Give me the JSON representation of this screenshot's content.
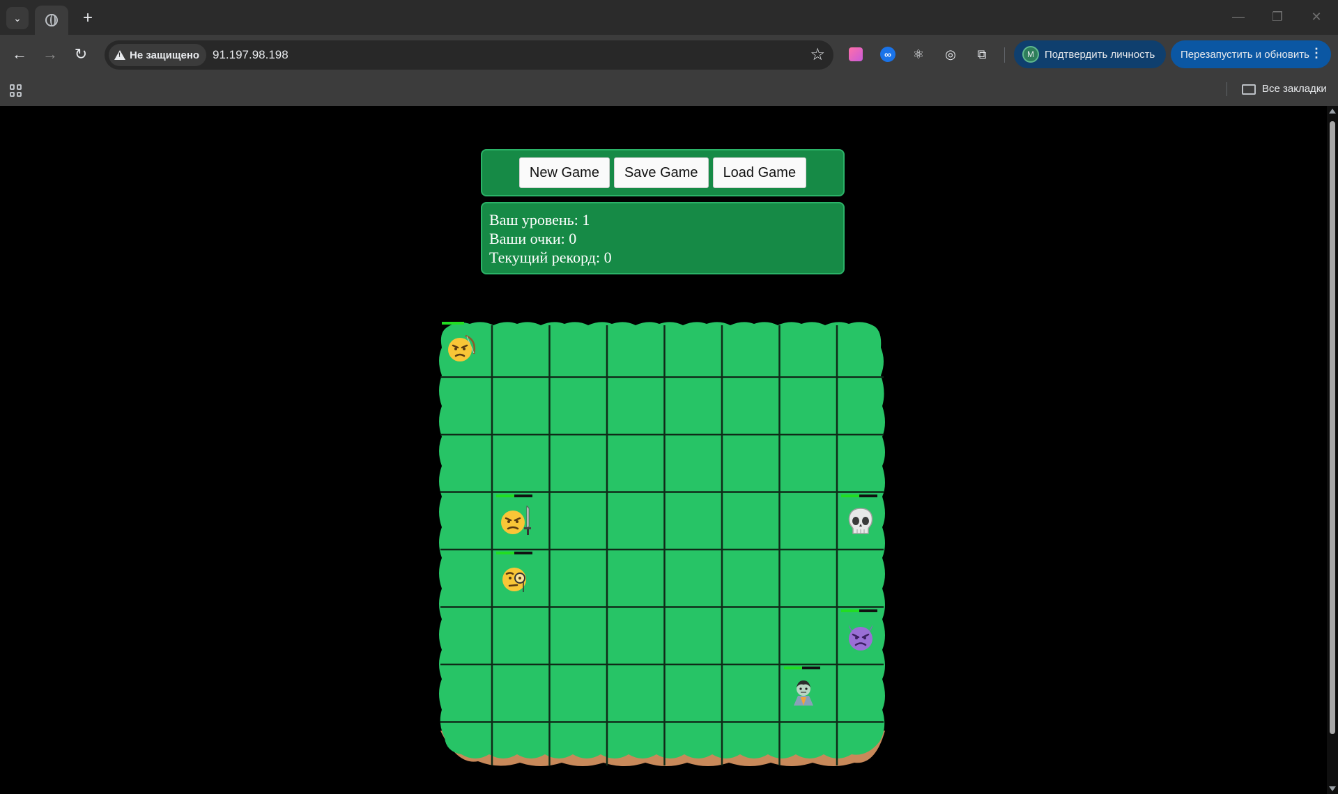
{
  "browser": {
    "security_label": "Не защищено",
    "url": "91.197.98.198",
    "verify_label": "Подтвердить личность",
    "verify_avatar": "M",
    "relaunch_label": "Перезапустить и обновить",
    "bookmarks_all": "Все закладки"
  },
  "controls": {
    "new_game": "New Game",
    "save_game": "Save Game",
    "load_game": "Load Game"
  },
  "stats": {
    "level": "Ваш уровень: 1",
    "points": "Ваши очки: 0",
    "record": "Текущий рекорд: 0"
  },
  "board": {
    "size": 8,
    "characters": [
      {
        "type": "bowman",
        "icon": "angry-face-bow-icon",
        "team": "player",
        "row": 0,
        "col": 0,
        "health": 0.5
      },
      {
        "type": "swordsman",
        "icon": "angry-face-sword-icon",
        "team": "player",
        "row": 3,
        "col": 1,
        "health": 0.5
      },
      {
        "type": "magician",
        "icon": "monocle-face-icon",
        "team": "player",
        "row": 4,
        "col": 1,
        "health": 0.5
      },
      {
        "type": "undead",
        "icon": "skull-icon",
        "team": "enemy",
        "row": 3,
        "col": 7,
        "health": 0.5
      },
      {
        "type": "daemon",
        "icon": "angry-devil-icon",
        "team": "enemy",
        "row": 5,
        "col": 7,
        "health": 0.5
      },
      {
        "type": "vampire",
        "icon": "vampire-icon",
        "team": "enemy",
        "row": 6,
        "col": 6,
        "health": 0.5
      }
    ]
  }
}
